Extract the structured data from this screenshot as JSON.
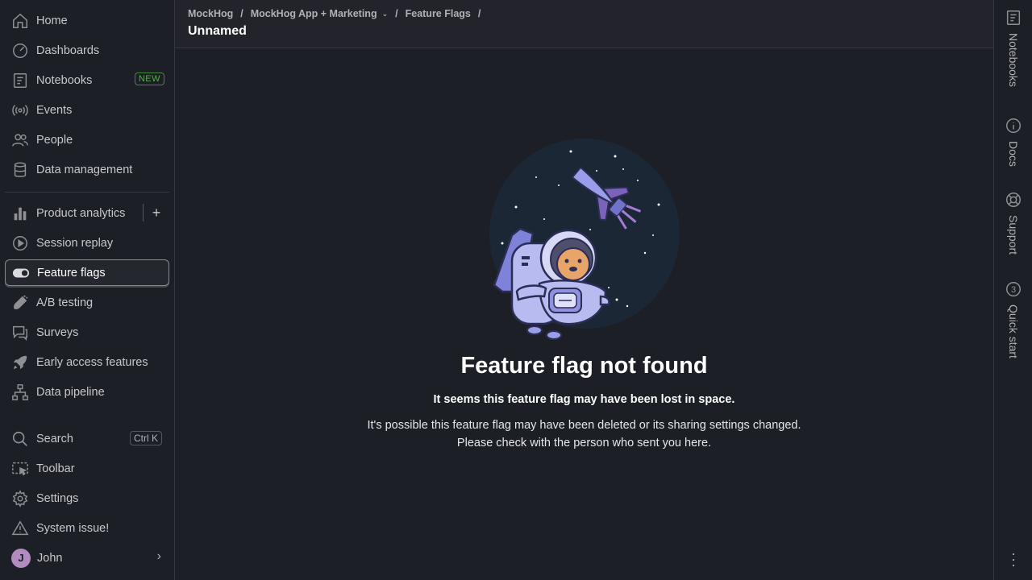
{
  "sidebar": {
    "items": [
      {
        "label": "Home",
        "icon": "home-icon"
      },
      {
        "label": "Dashboards",
        "icon": "dashboard-icon"
      },
      {
        "label": "Notebooks",
        "icon": "notebook-icon",
        "badge": "NEW"
      },
      {
        "label": "Events",
        "icon": "broadcast-icon"
      },
      {
        "label": "People",
        "icon": "people-icon"
      },
      {
        "label": "Data management",
        "icon": "database-icon"
      },
      {
        "label": "Product analytics",
        "icon": "bar-chart-icon"
      },
      {
        "label": "Session replay",
        "icon": "replay-icon"
      },
      {
        "label": "Feature flags",
        "icon": "toggle-icon"
      },
      {
        "label": "A/B testing",
        "icon": "flask-icon"
      },
      {
        "label": "Surveys",
        "icon": "chat-icon"
      },
      {
        "label": "Early access features",
        "icon": "rocket-icon"
      },
      {
        "label": "Data pipeline",
        "icon": "pipeline-icon"
      },
      {
        "label": "Search",
        "icon": "search-icon",
        "shortcut": "Ctrl K"
      },
      {
        "label": "Toolbar",
        "icon": "toolbar-icon"
      },
      {
        "label": "Settings",
        "icon": "gear-icon"
      },
      {
        "label": "System issue!",
        "icon": "warning-icon"
      }
    ],
    "user": {
      "initial": "J",
      "name": "John"
    },
    "add_label": "+"
  },
  "header": {
    "breadcrumb": [
      "MockHog",
      "MockHog App + Marketing",
      "Feature Flags"
    ],
    "separator": "/",
    "title": "Unnamed"
  },
  "main": {
    "title": "Feature flag not found",
    "subtitle": "It seems this feature flag may have been lost in space.",
    "description_line1": "It's possible this feature flag may have been deleted or its sharing settings changed.",
    "description_line2": "Please check with the person who sent you here."
  },
  "rightbar": {
    "items": [
      {
        "label": "Notebooks",
        "icon": "notebook-icon"
      },
      {
        "label": "Docs",
        "icon": "info-icon"
      },
      {
        "label": "Support",
        "icon": "lifebuoy-icon"
      },
      {
        "label": "Quick start",
        "icon": "counter-icon",
        "count": "3"
      }
    ]
  },
  "colors": {
    "background": "#1d1f27",
    "badge_new": "#54b04a",
    "avatar": "#b28bbf"
  }
}
